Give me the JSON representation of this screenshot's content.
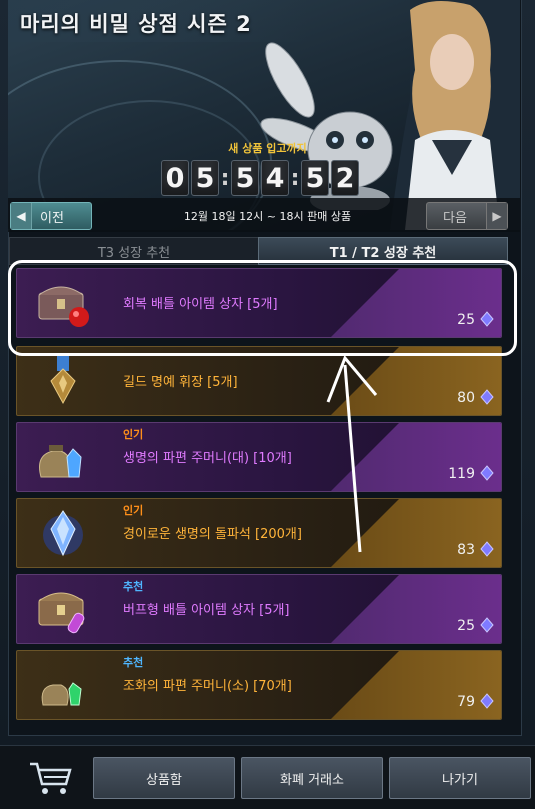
{
  "shop": {
    "title": "마리의 비밀 상점 시즌 2",
    "new_items_label": "새 상품 입고까지",
    "timer_digits": [
      "0",
      "5",
      "5",
      "4",
      "5",
      "2"
    ],
    "sale_period": "12월 18일 12시 ~ 18시 판매 상품"
  },
  "nav": {
    "prev_label": "이전",
    "next_label": "다음"
  },
  "tabs": [
    {
      "label": "T3 성장 추천",
      "active": false
    },
    {
      "label": "T1 / T2 성장 추천",
      "active": true
    }
  ],
  "items": [
    {
      "tag": "",
      "name": "회복 배틀 아이템 상자 [5개]",
      "price": "25",
      "theme": "purple",
      "icon": "red-chest-icon"
    },
    {
      "tag": "",
      "name": "길드 명예 휘장 [5개]",
      "price": "80",
      "theme": "gold",
      "icon": "medal-icon"
    },
    {
      "tag": "인기",
      "name": "생명의 파편 주머니(대) [10개]",
      "price": "119",
      "theme": "purple",
      "icon": "pouch-crystal-icon"
    },
    {
      "tag": "인기",
      "name": "경이로운 생명의 돌파석 [200개]",
      "price": "83",
      "theme": "gold",
      "icon": "blue-crystal-icon"
    },
    {
      "tag": "추천",
      "name": "버프형 배틀 아이템 상자 [5개]",
      "price": "25",
      "theme": "purple",
      "icon": "purple-chest-icon"
    },
    {
      "tag": "추천",
      "name": "조화의 파편 주머니(소) [70개]",
      "price": "79",
      "theme": "gold",
      "icon": "small-pouch-icon"
    }
  ],
  "bottom": {
    "storage_label": "상품함",
    "exchange_label": "화폐 거래소",
    "exit_label": "나가기"
  },
  "colors": {
    "purple_name": "#e07bff",
    "gold_name": "#ffb43a",
    "hot_tag": "#ff8f1a",
    "recommend_tag": "#4fb6ff",
    "timer_label": "#f0c33a"
  }
}
